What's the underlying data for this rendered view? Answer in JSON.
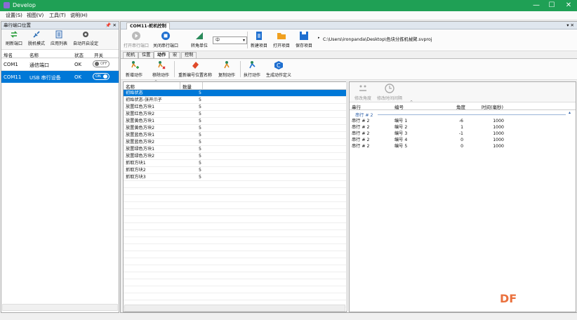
{
  "window": {
    "title": "Develop",
    "controls": [
      "—",
      "☐",
      "✕"
    ]
  },
  "menu": [
    "设置(S)",
    "视图(V)",
    "工具(T)",
    "说明(H)"
  ],
  "left_panel": {
    "title": "串行端口位置",
    "pin": "📌 ✕",
    "toolbar": [
      {
        "label": "刷新端口",
        "icon": "refresh-icon"
      },
      {
        "label": "脱机模式",
        "icon": "disconnect-icon"
      },
      {
        "label": "应用列表",
        "icon": "list-icon"
      },
      {
        "label": "自动开启设定",
        "icon": "gear-icon"
      }
    ],
    "columns": [
      "埠名",
      "名称",
      "状态",
      "开关"
    ],
    "rows": [
      {
        "port": "COM1",
        "name": "通信端口",
        "status": "OK",
        "switch": "OFF"
      },
      {
        "port": "COM11",
        "name": "USB 串行设备",
        "status": "OK",
        "switch": "ON"
      }
    ]
  },
  "doc_tab": {
    "label": "COM11-舵机控制",
    "close": "▾ ✕"
  },
  "main_toolbar": {
    "buttons": [
      {
        "label": "打开串行端口",
        "icon": "play-icon"
      },
      {
        "label": "关闭串行端口",
        "icon": "stop-icon"
      },
      {
        "label": "转角单位",
        "icon": "angle-icon"
      },
      {
        "label": "新建项目",
        "icon": "new-file-icon"
      },
      {
        "label": "打开项目",
        "icon": "folder-icon"
      },
      {
        "label": "保存项目",
        "icon": "save-icon"
      }
    ],
    "unit_select": "中",
    "project_path": "C:\\Users\\ironpanda\\Desktop\\色块分拣机械臂.svproj"
  },
  "sub_tabs": [
    "舵机",
    "位置",
    "动作",
    "宏",
    "控制"
  ],
  "action_toolbar": [
    {
      "label": "新增动作",
      "icon": "add-action-icon"
    },
    {
      "label": "移除动作",
      "icon": "remove-action-icon"
    },
    {
      "label": "重新编号位置名称",
      "icon": "eraser-icon"
    },
    {
      "label": "复制动作",
      "icon": "copy-action-icon"
    },
    {
      "label": "执行动作",
      "icon": "run-action-icon"
    },
    {
      "label": "生成动作定义",
      "icon": "code-icon"
    }
  ],
  "action_table": {
    "columns": [
      "名称",
      "数量"
    ],
    "rows": [
      {
        "name": "初始状态",
        "count": "5"
      },
      {
        "name": "初始状态-张开爪子",
        "count": "5"
      },
      {
        "name": "放置红色方块1",
        "count": "5"
      },
      {
        "name": "放置红色方块2",
        "count": "5"
      },
      {
        "name": "放置黄色方块1",
        "count": "5"
      },
      {
        "name": "放置黄色方块2",
        "count": "5"
      },
      {
        "name": "放置蓝色方块1",
        "count": "5"
      },
      {
        "name": "放置蓝色方块2",
        "count": "5"
      },
      {
        "name": "放置绿色方块1",
        "count": "5"
      },
      {
        "name": "放置绿色方块2",
        "count": "5"
      },
      {
        "name": "抓取方块1",
        "count": "5"
      },
      {
        "name": "抓取方块2",
        "count": "5"
      },
      {
        "name": "抓取方块3",
        "count": "5"
      }
    ]
  },
  "right_toolbar": [
    {
      "label": "修改角度",
      "icon": "edit-angle-icon"
    },
    {
      "label": "修改时间间隔",
      "icon": "clock-icon"
    }
  ],
  "servo_table": {
    "columns": [
      "串行",
      "编号",
      "角度",
      "时间(毫秒)"
    ],
    "group": "串行 # 2",
    "rows": [
      {
        "serial": "串行 # 2",
        "id": "编号 1",
        "angle": "-6",
        "time": "1000"
      },
      {
        "serial": "串行 # 2",
        "id": "编号 2",
        "angle": "1",
        "time": "1000"
      },
      {
        "serial": "串行 # 2",
        "id": "编号 3",
        "angle": "-1",
        "time": "1000"
      },
      {
        "serial": "串行 # 2",
        "id": "编号 4",
        "angle": "0",
        "time": "1000"
      },
      {
        "serial": "串行 # 2",
        "id": "编号 5",
        "angle": "0",
        "time": "1000"
      }
    ]
  },
  "watermark": "DF"
}
